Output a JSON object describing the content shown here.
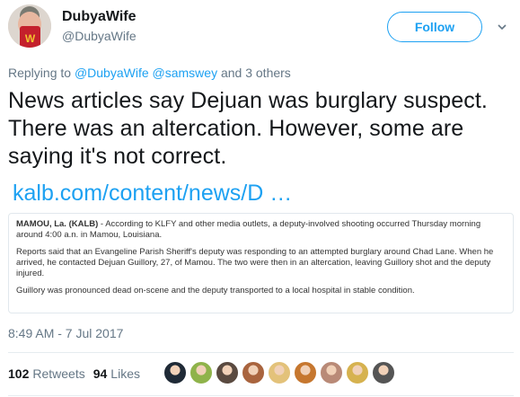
{
  "author": {
    "name": "DubyaWife",
    "handle": "@DubyaWife"
  },
  "follow_label": "Follow",
  "reply": {
    "prefix": "Replying to",
    "mention1": "@DubyaWife",
    "mention2": "@samswey",
    "suffix": "and 3 others"
  },
  "tweet": {
    "text": "News articles say Dejuan was burglary suspect. There was an altercation. However, some are saying it's not correct.",
    "link": "kalb.com/content/news/D …"
  },
  "card": {
    "dateline": "MAMOU, La. (KALB)",
    "p1": " - According to KLFY and other media outlets, a deputy-involved shooting occurred Thursday morning around 4:00 a.n. in Mamou, Louisiana.",
    "p2": "Reports said that an Evangeline Parish Sheriff's deputy was responding to an attempted burglary around Chad Lane. When he arrived, he contacted Dejuan Guillory, 27, of Mamou. The two were then in an altercation, leaving Guillory shot and the deputy injured.",
    "p3": "Guillory was pronounced dead on-scene and the deputy transported to a local hospital in stable condition."
  },
  "timestamp": "8:49 AM - 7 Jul 2017",
  "stats": {
    "retweets_count": "102",
    "retweets_label": "Retweets",
    "likes_count": "94",
    "likes_label": "Likes"
  },
  "colors": {
    "accent": "#1da1f2",
    "secondary_text": "#657786",
    "primary_text": "#14171a",
    "border": "#e1e8ed"
  },
  "icons": {
    "menu": "chevron-down-icon"
  },
  "likers": [
    {
      "color": "#1f2a36"
    },
    {
      "color": "#8fb34a"
    },
    {
      "color": "#5a4a40"
    },
    {
      "color": "#a9643e"
    },
    {
      "color": "#e3c27a"
    },
    {
      "color": "#c6772f"
    },
    {
      "color": "#b98a77"
    },
    {
      "color": "#d6b24f"
    },
    {
      "color": "#555555"
    }
  ]
}
